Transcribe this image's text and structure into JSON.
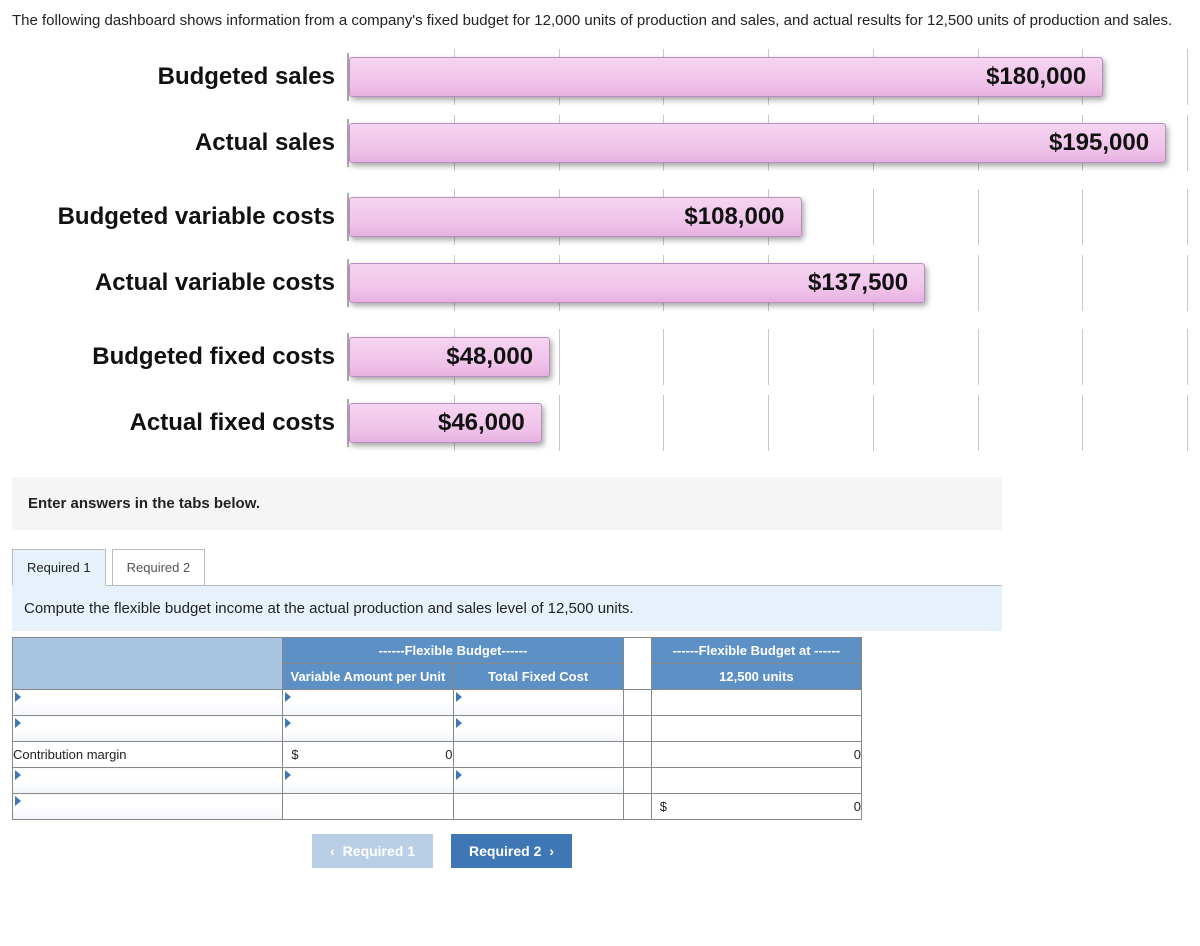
{
  "intro": "The following dashboard shows information from a company's fixed budget for 12,000 units of production and sales, and actual results for 12,500 units of production and sales.",
  "chart_data": {
    "type": "bar",
    "orientation": "horizontal",
    "max": 200000,
    "categories": [
      "Budgeted sales",
      "Actual sales",
      "Budgeted variable costs",
      "Actual variable costs",
      "Budgeted fixed costs",
      "Actual fixed costs"
    ],
    "values": [
      180000,
      195000,
      108000,
      137500,
      48000,
      46000
    ],
    "labels": [
      "$180,000",
      "$195,000",
      "$108,000",
      "$137,500",
      "$48,000",
      "$46,000"
    ]
  },
  "answer_prompt": "Enter answers in the tabs below.",
  "tabs": {
    "t1": "Required 1",
    "t2": "Required 2"
  },
  "instruction": "Compute the flexible budget income at the actual production and sales level of 12,500 units.",
  "table": {
    "header_group_left": "------Flexible Budget------",
    "header_group_right": "------Flexible Budget at ------",
    "col_va": "Variable Amount per Unit",
    "col_tf": "Total Fixed Cost",
    "col_units": "12,500 units",
    "rows": {
      "contrib_label": "Contribution margin",
      "currency": "$",
      "zero": "0"
    }
  },
  "nav": {
    "prev": "Required 1",
    "next": "Required 2"
  }
}
